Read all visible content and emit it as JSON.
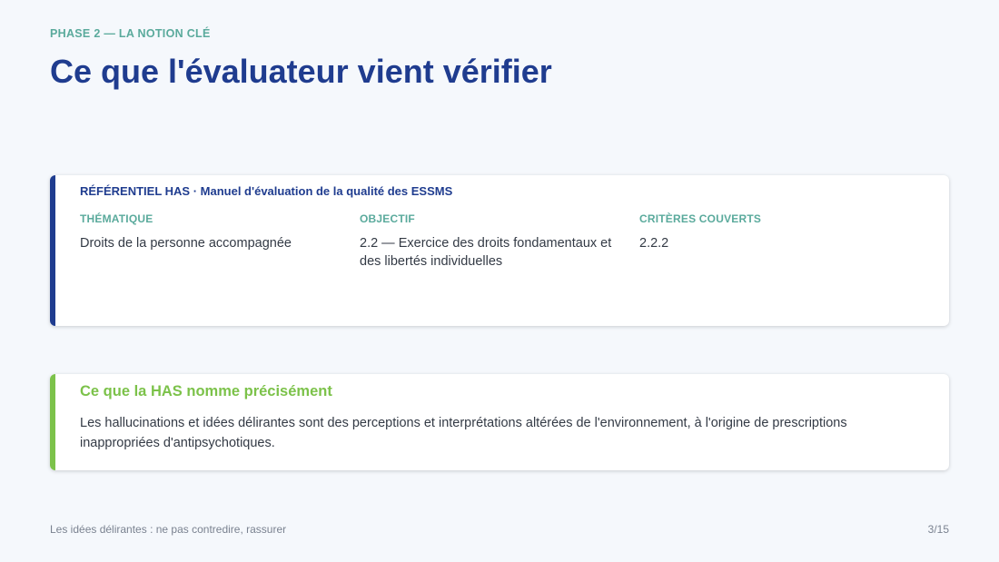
{
  "header": {
    "eyebrow": "PHASE 2 — LA NOTION CLÉ",
    "title": "Ce que l'évaluateur vient vérifier"
  },
  "referentiel": {
    "heading": "RÉFÉRENTIEL HAS · Manuel d'évaluation de la qualité des ESSMS",
    "columns": [
      {
        "label": "THÉMATIQUE",
        "value": "Droits de la personne accompagnée"
      },
      {
        "label": "OBJECTIF",
        "value": "2.2 — Exercice des droits fondamentaux et des libertés individuelles"
      },
      {
        "label": "CRITÈRES COUVERTS",
        "value": "2.2.2"
      }
    ]
  },
  "has_box": {
    "heading": "Ce que la HAS nomme précisément",
    "text": "Les hallucinations et idées délirantes sont des perceptions et interprétations altérées de l'environnement, à l'origine de prescriptions inappropriées d'antipsychotiques."
  },
  "footer": {
    "left": "Les idées délirantes : ne pas contredire, rassurer",
    "page": "3/15"
  },
  "colors": {
    "primary": "#1f3c8f",
    "teal": "#5aaa9c",
    "green": "#7cc24a",
    "background": "#f5f8fc"
  }
}
